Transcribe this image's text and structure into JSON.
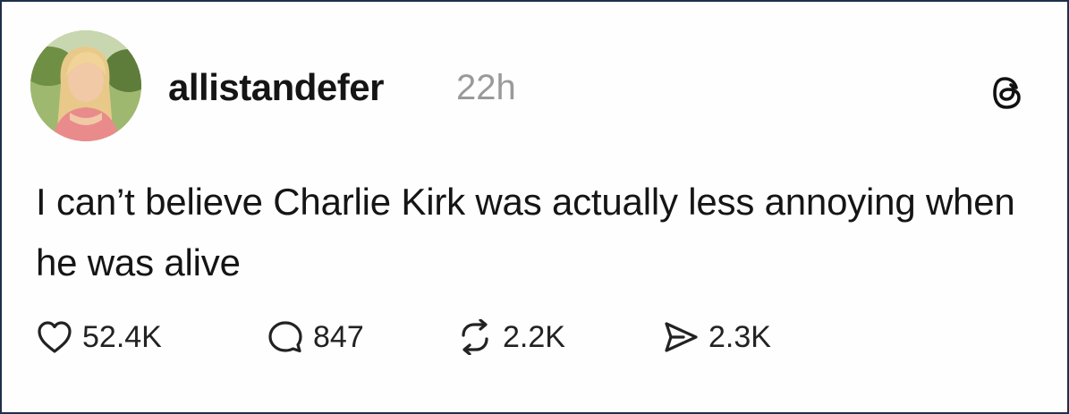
{
  "post": {
    "username": "allistandefer",
    "timestamp": "22h",
    "text": "I can’t believe Charlie Kirk was actually less annoying when he was alive",
    "avatar_icon": "user-avatar-photo",
    "platform_icon": "threads-logo-icon"
  },
  "actions": {
    "like": {
      "icon": "heart-icon",
      "count": "52.4K"
    },
    "reply": {
      "icon": "comment-bubble-icon",
      "count": "847"
    },
    "repost": {
      "icon": "repost-arrows-icon",
      "count": "2.2K"
    },
    "share": {
      "icon": "send-icon",
      "count": "2.3K"
    }
  },
  "colors": {
    "border": "#1f2f4a",
    "text": "#151515",
    "muted": "#9a9a9a"
  }
}
